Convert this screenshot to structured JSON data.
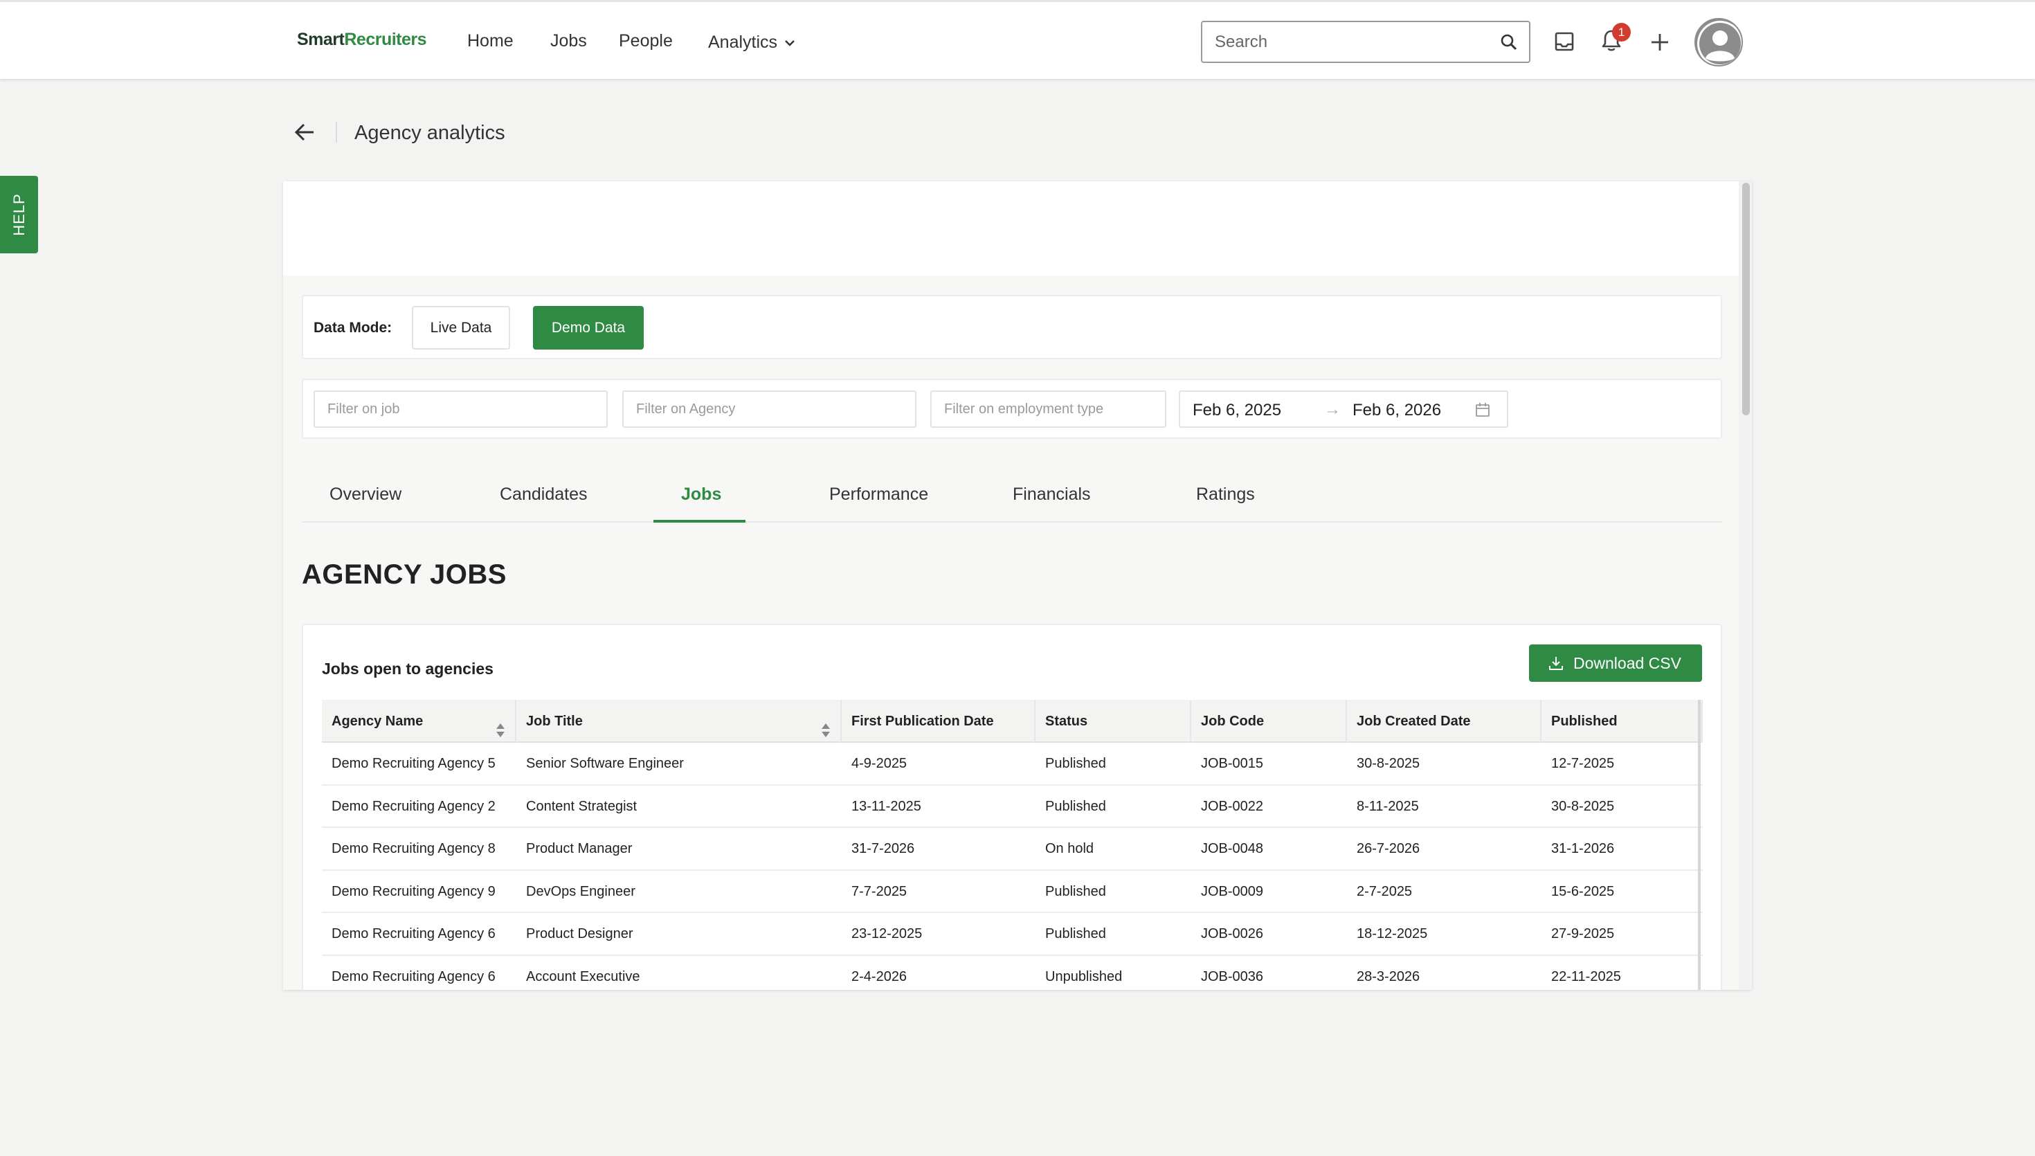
{
  "nav": {
    "logo_part1": "Smart",
    "logo_part2": "Recruiters",
    "home": "Home",
    "jobs": "Jobs",
    "people": "People",
    "analytics": "Analytics",
    "search_placeholder": "Search",
    "notification_count": "1"
  },
  "help": "HELP",
  "page": {
    "title": "Agency analytics"
  },
  "data_mode": {
    "label": "Data Mode:",
    "live": "Live Data",
    "demo": "Demo Data",
    "selected": "Demo Data"
  },
  "filters": {
    "job_placeholder": "Filter on job",
    "agency_placeholder": "Filter on Agency",
    "employment_placeholder": "Filter on employment type",
    "date_start": "Feb 6, 2025",
    "date_end": "Feb 6, 2026"
  },
  "tabs": {
    "overview": "Overview",
    "candidates": "Candidates",
    "jobs": "Jobs",
    "performance": "Performance",
    "financials": "Financials",
    "ratings": "Ratings",
    "active": "Jobs"
  },
  "section_title": "AGENCY JOBS",
  "jobs_panel": {
    "label": "Jobs open to agencies",
    "download_label": "Download CSV"
  },
  "table": {
    "columns": [
      "Agency Name",
      "Job Title",
      "First Publication Date",
      "Status",
      "Job Code",
      "Job Created Date",
      "Published"
    ],
    "rows": [
      [
        "Demo Recruiting Agency 5",
        "Senior Software Engineer",
        "4-9-2025",
        "Published",
        "JOB-0015",
        "30-8-2025",
        "12-7-2025"
      ],
      [
        "Demo Recruiting Agency 2",
        "Content Strategist",
        "13-11-2025",
        "Published",
        "JOB-0022",
        "8-11-2025",
        "30-8-2025"
      ],
      [
        "Demo Recruiting Agency 8",
        "Product Manager",
        "31-7-2026",
        "On hold",
        "JOB-0048",
        "26-7-2026",
        "31-1-2026"
      ],
      [
        "Demo Recruiting Agency 9",
        "DevOps Engineer",
        "7-7-2025",
        "Published",
        "JOB-0009",
        "2-7-2025",
        "15-6-2025"
      ],
      [
        "Demo Recruiting Agency 6",
        "Product Designer",
        "23-12-2025",
        "Published",
        "JOB-0026",
        "18-12-2025",
        "27-9-2025"
      ],
      [
        "Demo Recruiting Agency 6",
        "Account Executive",
        "2-4-2026",
        "Unpublished",
        "JOB-0036",
        "28-3-2026",
        "22-11-2025"
      ]
    ]
  },
  "colors": {
    "brand_green": "#2f8a43",
    "badge_red": "#d23b2f"
  }
}
